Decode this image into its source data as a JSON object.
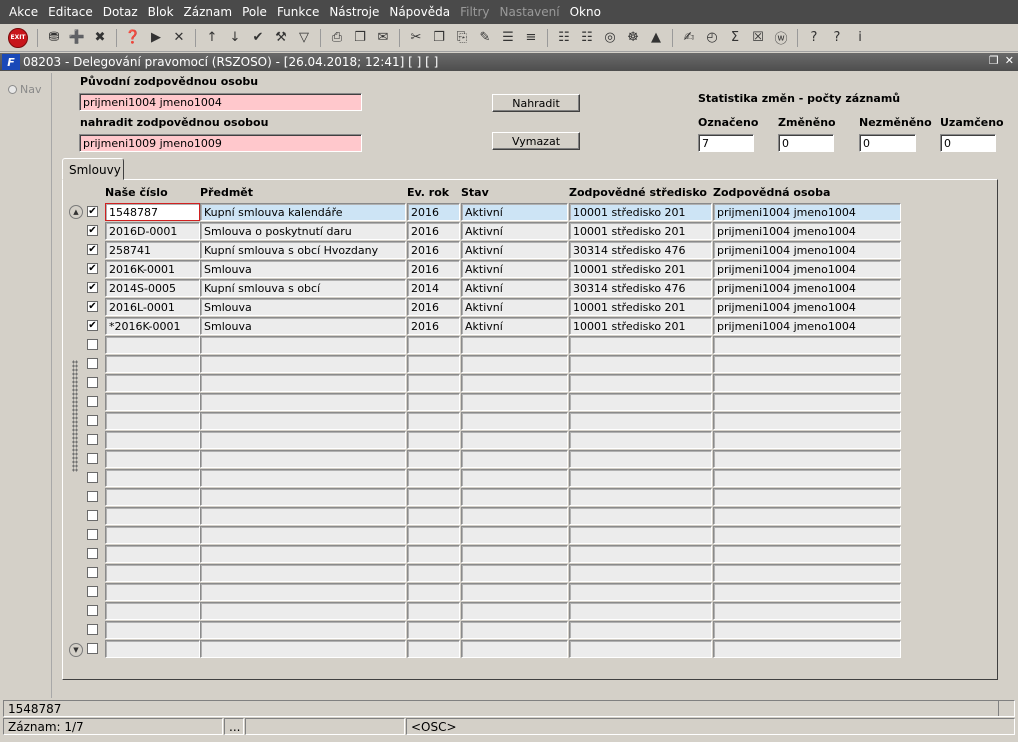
{
  "menu": [
    "Akce",
    "Editace",
    "Dotaz",
    "Blok",
    "Záznam",
    "Pole",
    "Funkce",
    "Nástroje",
    "Nápověda",
    "Filtry",
    "Nastavení",
    "Okno"
  ],
  "menu_disabled": [
    "Filtry",
    "Nastavení"
  ],
  "toolbar": {
    "exit_label": "EXIT",
    "icons": [
      "exit-icon",
      "save-icon",
      "new-record-icon",
      "delete-record-icon",
      "query-icon",
      "execute-query-icon",
      "cancel-query-icon",
      "sort-asc-icon",
      "sort-desc-icon",
      "check-icon",
      "wrench-icon",
      "filter-icon",
      "print-icon",
      "print-preview-icon",
      "mail-icon",
      "cut-icon",
      "copy-icon",
      "paste-icon",
      "edit-icon",
      "list-icon",
      "tree-icon",
      "clipboard-icon",
      "document-icon",
      "globe-icon",
      "ship-wheel-icon",
      "mountain-icon",
      "sign-icon",
      "clock-icon",
      "sum-icon",
      "excel-icon",
      "word-icon",
      "help-icon",
      "help-context-icon",
      "info-icon"
    ]
  },
  "window": {
    "logo": "F",
    "title": "08203 - Delegování pravomocí (RSZOSO) - [26.04.2018; 12:41]  [ ]  [ ]"
  },
  "nav": {
    "label": "Nav"
  },
  "form": {
    "original_label": "Původní zodpovědnou osobu",
    "original_value": "prijmeni1004 jmeno1004",
    "replace_label": "nahradit zodpovědnou osobou",
    "replace_value": "prijmeni1009 jmeno1009",
    "replace_button": "Nahradit",
    "clear_button": "Vymazat"
  },
  "stats": {
    "title": "Statistika změn - počty záznamů",
    "labels": [
      "Označeno",
      "Změněno",
      "Nezměněno",
      "Uzamčeno"
    ],
    "values": [
      "7",
      "0",
      "0",
      "0"
    ]
  },
  "tab": {
    "label": "Smlouvy"
  },
  "grid": {
    "headers": [
      "Naše číslo",
      "Předmět",
      "Ev. rok",
      "Stav",
      "Zodpovědné středisko",
      "Zodpovědná osoba"
    ],
    "rows": [
      {
        "checked": true,
        "cells": [
          "1548787",
          "Kupní smlouva kalendáře",
          "2016",
          "Aktivní",
          "10001 středisko 201",
          "prijmeni1004 jmeno1004"
        ]
      },
      {
        "checked": true,
        "cells": [
          "2016D-0001",
          "Smlouva o poskytnutí daru",
          "2016",
          "Aktivní",
          "10001 středisko 201",
          "prijmeni1004 jmeno1004"
        ]
      },
      {
        "checked": true,
        "cells": [
          "258741",
          "Kupní smlouva s obcí Hvozdany",
          "2016",
          "Aktivní",
          "30314 středisko 476",
          "prijmeni1004 jmeno1004"
        ]
      },
      {
        "checked": true,
        "cells": [
          "2016K-0001",
          "Smlouva",
          "2016",
          "Aktivní",
          "10001 středisko 201",
          "prijmeni1004 jmeno1004"
        ]
      },
      {
        "checked": true,
        "cells": [
          "2014S-0005",
          "Kupní smlouva s obcí",
          "2014",
          "Aktivní",
          "30314 středisko 476",
          "prijmeni1004 jmeno1004"
        ]
      },
      {
        "checked": true,
        "cells": [
          "2016L-0001",
          "Smlouva",
          "2016",
          "Aktivní",
          "10001 středisko 201",
          "prijmeni1004 jmeno1004"
        ]
      },
      {
        "checked": true,
        "cells": [
          "*2016K-0001",
          "Smlouva",
          "2016",
          "Aktivní",
          "10001 středisko 201",
          "prijmeni1004 jmeno1004"
        ]
      },
      {
        "checked": false,
        "cells": [
          "",
          "",
          "",
          "",
          "",
          ""
        ]
      },
      {
        "checked": false,
        "cells": [
          "",
          "",
          "",
          "",
          "",
          ""
        ]
      },
      {
        "checked": false,
        "cells": [
          "",
          "",
          "",
          "",
          "",
          ""
        ]
      },
      {
        "checked": false,
        "cells": [
          "",
          "",
          "",
          "",
          "",
          ""
        ]
      },
      {
        "checked": false,
        "cells": [
          "",
          "",
          "",
          "",
          "",
          ""
        ]
      },
      {
        "checked": false,
        "cells": [
          "",
          "",
          "",
          "",
          "",
          ""
        ]
      },
      {
        "checked": false,
        "cells": [
          "",
          "",
          "",
          "",
          "",
          ""
        ]
      },
      {
        "checked": false,
        "cells": [
          "",
          "",
          "",
          "",
          "",
          ""
        ]
      },
      {
        "checked": false,
        "cells": [
          "",
          "",
          "",
          "",
          "",
          ""
        ]
      },
      {
        "checked": false,
        "cells": [
          "",
          "",
          "",
          "",
          "",
          ""
        ]
      },
      {
        "checked": false,
        "cells": [
          "",
          "",
          "",
          "",
          "",
          ""
        ]
      },
      {
        "checked": false,
        "cells": [
          "",
          "",
          "",
          "",
          "",
          ""
        ]
      },
      {
        "checked": false,
        "cells": [
          "",
          "",
          "",
          "",
          "",
          ""
        ]
      },
      {
        "checked": false,
        "cells": [
          "",
          "",
          "",
          "",
          "",
          ""
        ]
      },
      {
        "checked": false,
        "cells": [
          "",
          "",
          "",
          "",
          "",
          ""
        ]
      },
      {
        "checked": false,
        "cells": [
          "",
          "",
          "",
          "",
          "",
          ""
        ]
      },
      {
        "checked": false,
        "cells": [
          "",
          "",
          "",
          "",
          "",
          ""
        ]
      }
    ]
  },
  "status": {
    "message": "1548787",
    "record": "Záznam: 1/7",
    "ellipsis": "...",
    "mode": "<OSC>"
  }
}
